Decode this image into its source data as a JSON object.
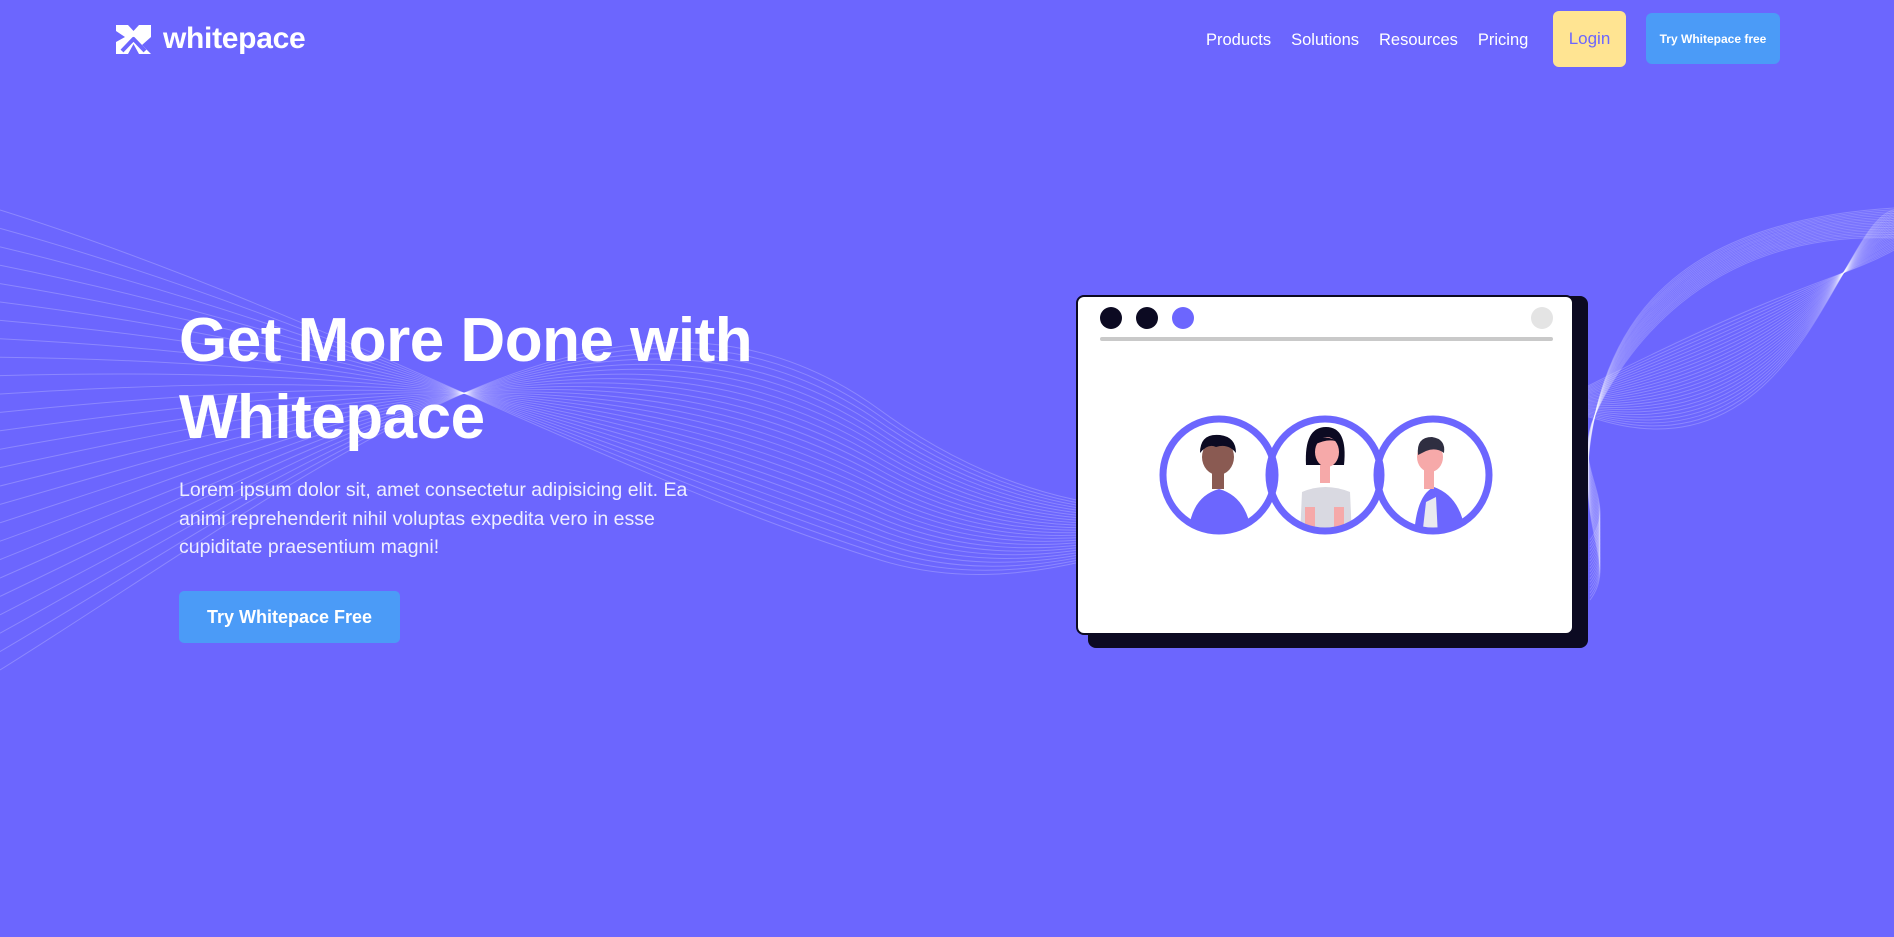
{
  "brand": {
    "name": "whitepace"
  },
  "nav": {
    "links": [
      "Products",
      "Solutions",
      "Resources",
      "Pricing"
    ],
    "login_label": "Login",
    "try_label": "Try Whitepace free"
  },
  "hero": {
    "title": "Get More Done with Whitepace",
    "description": "Lorem ipsum dolor sit, amet consectetur adipisicing elit. Ea animi reprehenderit nihil voluptas expedita vero in esse cupiditate praesentium magni!",
    "cta_label": "Try Whitepace Free"
  },
  "colors": {
    "background": "#6c66fe",
    "login_bg": "#ffe492",
    "cta_blue": "#4b9bf7",
    "dark": "#0c0a22"
  },
  "illustration": {
    "icons": [
      "window-dot-icon",
      "avatar-person-icon"
    ]
  }
}
